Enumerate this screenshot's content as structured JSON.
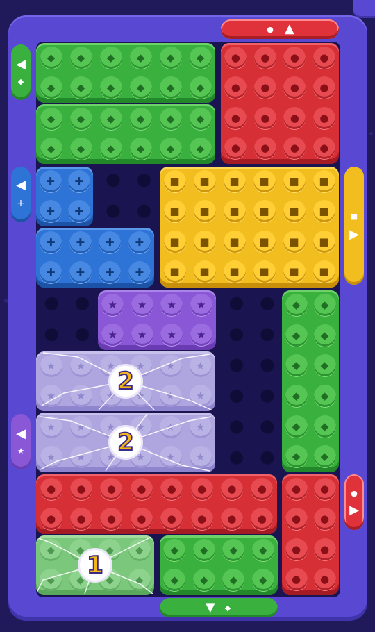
{
  "game": {
    "colors": {
      "green": "#3ab03e",
      "red": "#d62f35",
      "blue": "#2e73d6",
      "yellow": "#f1bd1f",
      "purple": "#8a58d6",
      "board": "#1a1550",
      "frame": "#5848d2"
    },
    "exits": [
      {
        "id": "exit-top-red",
        "color": "red",
        "arrow": "▲",
        "symbol": "●"
      },
      {
        "id": "exit-left-green",
        "color": "green",
        "arrow": "◀",
        "symbol": "◆"
      },
      {
        "id": "exit-left-blue",
        "color": "blue",
        "arrow": "◀",
        "symbol": "+"
      },
      {
        "id": "exit-right-yellow",
        "color": "yellow",
        "arrow": "▶",
        "symbol": "■"
      },
      {
        "id": "exit-left-purple",
        "color": "purple",
        "arrow": "◀",
        "symbol": "★"
      },
      {
        "id": "exit-right-red",
        "color": "red",
        "arrow": "▶",
        "symbol": "●"
      },
      {
        "id": "exit-bottom-green",
        "color": "green",
        "arrow": "▼",
        "symbol": "◆"
      }
    ],
    "blocks": [
      {
        "id": "green-top-1",
        "color": "green",
        "symbol": "◆",
        "cols": 6,
        "rows": 2
      },
      {
        "id": "green-top-2",
        "color": "green",
        "symbol": "◆",
        "cols": 6,
        "rows": 2
      },
      {
        "id": "red-top",
        "color": "red",
        "symbol": "●",
        "cols": 4,
        "rows": 4
      },
      {
        "id": "blue-small",
        "color": "blue",
        "symbol": "✚",
        "cols": 2,
        "rows": 2
      },
      {
        "id": "blue-wide",
        "color": "blue",
        "symbol": "✚",
        "cols": 4,
        "rows": 2
      },
      {
        "id": "yellow-big",
        "color": "yellow",
        "symbol": "■",
        "cols": 6,
        "rows": 4
      },
      {
        "id": "purple",
        "color": "purple",
        "symbol": "★",
        "cols": 4,
        "rows": 2
      },
      {
        "id": "green-tall",
        "color": "green",
        "symbol": "◆",
        "cols": 2,
        "rows": 6
      },
      {
        "id": "locked-purple-1",
        "color": "purple",
        "symbol": "★",
        "cols": 6,
        "rows": 2,
        "counter": "2"
      },
      {
        "id": "locked-purple-2",
        "color": "purple",
        "symbol": "★",
        "cols": 6,
        "rows": 2,
        "counter": "2"
      },
      {
        "id": "red-wide",
        "color": "red",
        "symbol": "●",
        "cols": 8,
        "rows": 2
      },
      {
        "id": "red-right",
        "color": "red",
        "symbol": "●",
        "cols": 2,
        "rows": 4
      },
      {
        "id": "locked-green",
        "color": "green",
        "symbol": "◆",
        "cols": 4,
        "rows": 2,
        "counter": "1"
      },
      {
        "id": "green-bottom",
        "color": "green",
        "symbol": "◆",
        "cols": 4,
        "rows": 2
      }
    ],
    "counters": {
      "locked_purple_1": "2",
      "locked_purple_2": "2",
      "locked_green": "1"
    }
  }
}
